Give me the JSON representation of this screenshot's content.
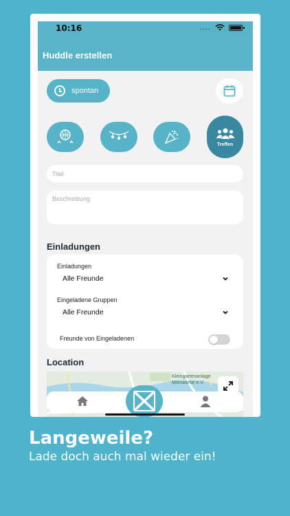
{
  "status_bar": {
    "time": "10:16",
    "signal": "....",
    "wifi_icon": "wifi-icon",
    "battery_icon": "battery-icon"
  },
  "header": {
    "title": "Huddle erstellen"
  },
  "time_mode": {
    "label": "spontan",
    "icon": "clock-icon"
  },
  "calendar_button": {
    "icon": "calendar-icon"
  },
  "categories": [
    {
      "icon": "basketball-icon",
      "selected": false
    },
    {
      "icon": "party-lights-icon",
      "selected": false
    },
    {
      "icon": "party-popper-icon",
      "selected": false
    },
    {
      "icon": "people-icon",
      "label": "Treffen",
      "selected": true
    }
  ],
  "form": {
    "title_placeholder": "Titel",
    "description_placeholder": "Beschreibung"
  },
  "invitations": {
    "section_title": "Einladungen",
    "invites_label": "Einladungen",
    "invites_value": "Alle Freunde",
    "groups_label": "Eingeladene Gruppen",
    "groups_value": "Alle Freunde",
    "friends_of_invitees_label": "Freunde von Eingeladenen",
    "friends_of_invitees_enabled": false
  },
  "location": {
    "section_title": "Location",
    "map_poi_line1": "Kleingartenanlage",
    "map_poi_line2": "Mörswiese e.V."
  },
  "tabbar": {
    "home_icon": "home-icon",
    "center_icon": "huddle-logo-icon",
    "profile_icon": "user-icon"
  },
  "marketing": {
    "headline": "Langeweile?",
    "subline": "Lade doch auch mal wieder ein!"
  },
  "colors": {
    "background": "#4fb3cb",
    "primary": "#57b4c8",
    "selected": "#3a87a0",
    "header": "#5ab4c9"
  }
}
